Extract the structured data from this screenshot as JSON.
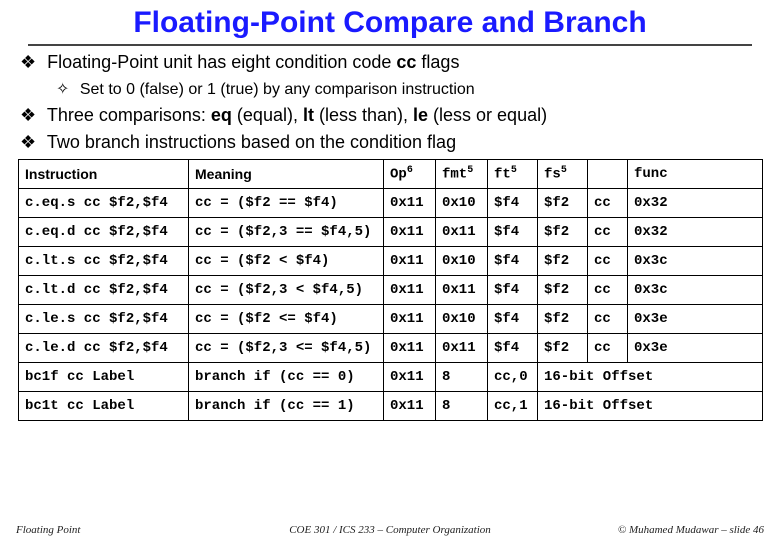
{
  "title": "Floating-Point Compare and Branch",
  "bullets": {
    "b1a_pre": "Floating-Point unit has eight condition code ",
    "b1a_cc": "cc",
    "b1a_post": " flags",
    "b1a_sub": "Set to 0 (false) or 1 (true) by any comparison instruction",
    "b2_pre": "Three comparisons: ",
    "b2_eq": "eq",
    "b2_eq_t": " (equal), ",
    "b2_lt": "lt",
    "b2_lt_t": " (less than), ",
    "b2_le": "le",
    "b2_le_t": " (less or equal)",
    "b3": "Two branch instructions based on the condition flag"
  },
  "headers": {
    "instr": "Instruction",
    "meaning": "Meaning",
    "op": "Op",
    "op_sup": "6",
    "fmt": "fmt",
    "fmt_sup": "5",
    "ft": "ft",
    "ft_sup": "5",
    "fs": "fs",
    "fs_sup": "5",
    "func": "func"
  },
  "rows": [
    {
      "instr": "c.eq.s cc $f2,$f4",
      "meaning": "cc = ($f2 == $f4)",
      "op": "0x11",
      "fmt": "0x10",
      "ft": "$f4",
      "fs": "$f2",
      "blank": "cc",
      "func": "0x32"
    },
    {
      "instr": "c.eq.d cc $f2,$f4",
      "meaning": "cc = ($f2,3 == $f4,5)",
      "op": "0x11",
      "fmt": "0x11",
      "ft": "$f4",
      "fs": "$f2",
      "blank": "cc",
      "func": "0x32"
    },
    {
      "instr": "c.lt.s cc $f2,$f4",
      "meaning": "cc = ($f2 < $f4)",
      "op": "0x11",
      "fmt": "0x10",
      "ft": "$f4",
      "fs": "$f2",
      "blank": "cc",
      "func": "0x3c"
    },
    {
      "instr": "c.lt.d cc $f2,$f4",
      "meaning": "cc = ($f2,3 < $f4,5)",
      "op": "0x11",
      "fmt": "0x11",
      "ft": "$f4",
      "fs": "$f2",
      "blank": "cc",
      "func": "0x3c"
    },
    {
      "instr": "c.le.s cc $f2,$f4",
      "meaning": "cc = ($f2 <= $f4)",
      "op": "0x11",
      "fmt": "0x10",
      "ft": "$f4",
      "fs": "$f2",
      "blank": "cc",
      "func": "0x3e"
    },
    {
      "instr": "c.le.d cc $f2,$f4",
      "meaning": "cc = ($f2,3 <= $f4,5)",
      "op": "0x11",
      "fmt": "0x11",
      "ft": "$f4",
      "fs": "$f2",
      "blank": "cc",
      "func": "0x3e"
    }
  ],
  "branch_rows": [
    {
      "instr": "bc1f cc Label",
      "meaning": "branch if (cc == 0)",
      "op": "0x11",
      "fmt": "8",
      "ft": "cc,0",
      "offset": "16-bit Offset"
    },
    {
      "instr": "bc1t cc Label",
      "meaning": "branch if (cc == 1)",
      "op": "0x11",
      "fmt": "8",
      "ft": "cc,1",
      "offset": "16-bit Offset"
    }
  ],
  "footer": {
    "left": "Floating Point",
    "center": "COE 301 / ICS 233 – Computer Organization",
    "right": "© Muhamed Mudawar – slide 46"
  }
}
